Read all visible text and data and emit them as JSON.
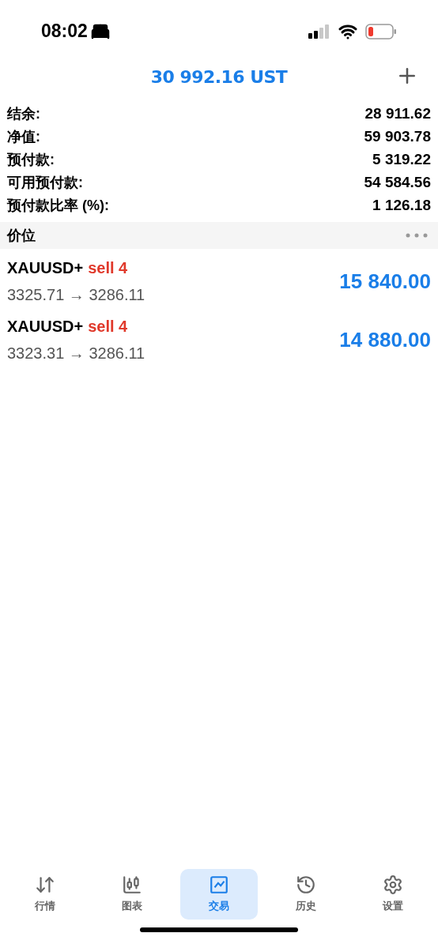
{
  "status_bar": {
    "time": "08:02"
  },
  "header": {
    "title": "30 992.16 UST"
  },
  "summary": [
    {
      "label": "结余:",
      "value": "28 911.62"
    },
    {
      "label": "净值:",
      "value": "59 903.78"
    },
    {
      "label": "预付款:",
      "value": "5 319.22"
    },
    {
      "label": "可用预付款:",
      "value": "54 584.56"
    },
    {
      "label": "预付款比率 (%):",
      "value": "1 126.18"
    }
  ],
  "section": {
    "title": "价位"
  },
  "positions": [
    {
      "symbol": "XAUUSD+",
      "side": "sell 4",
      "kind": "sell",
      "prices": "3325.71 → 3286.11",
      "profit": "15 840.00"
    },
    {
      "symbol": "XAUUSD+",
      "side": "sell 4",
      "kind": "sell",
      "prices": "3323.31 → 3286.11",
      "profit": "14 880.00"
    }
  ],
  "tabs": [
    {
      "kind": "quotes",
      "label": "行情",
      "selected": false
    },
    {
      "kind": "chart",
      "label": "图表",
      "selected": false
    },
    {
      "kind": "trade",
      "label": "交易",
      "selected": true
    },
    {
      "kind": "history",
      "label": "历史",
      "selected": false
    },
    {
      "kind": "settings",
      "label": "设置",
      "selected": false
    }
  ]
}
